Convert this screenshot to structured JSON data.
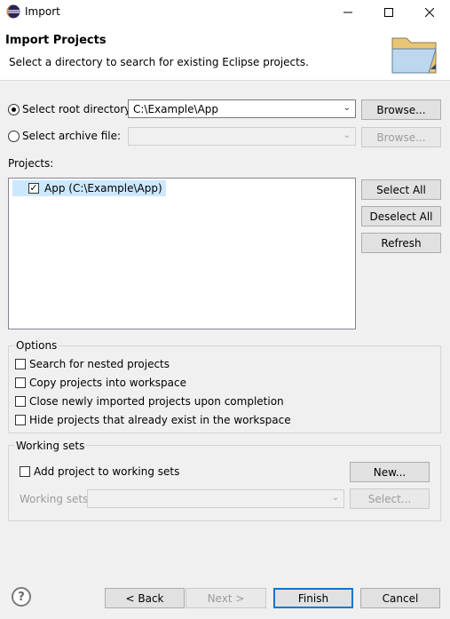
{
  "window": {
    "title": "Import"
  },
  "header": {
    "title": "Import Projects",
    "description": "Select a directory to search for existing Eclipse projects."
  },
  "source": {
    "root_label": "Select root directory:",
    "root_value": "C:\\Example\\App",
    "archive_label": "Select archive file:",
    "archive_value": "",
    "browse_label": "Browse...",
    "selected": "root"
  },
  "projects": {
    "label": "Projects:",
    "items": [
      {
        "label": "App (C:\\Example\\App)",
        "checked": true
      }
    ],
    "select_all": "Select All",
    "deselect_all": "Deselect All",
    "refresh": "Refresh"
  },
  "options": {
    "title": "Options",
    "items": [
      {
        "label": "Search for nested projects",
        "checked": false
      },
      {
        "label": "Copy projects into workspace",
        "checked": false
      },
      {
        "label": "Close newly imported projects upon completion",
        "checked": false
      },
      {
        "label": "Hide projects that already exist in the workspace",
        "checked": false
      }
    ]
  },
  "working_sets": {
    "title": "Working sets",
    "add_label": "Add project to working sets",
    "add_checked": false,
    "new_label": "New...",
    "sets_label": "Working sets:",
    "sets_value": "",
    "select_label": "Select..."
  },
  "footer": {
    "help": "?",
    "back": "< Back",
    "next": "Next >",
    "finish": "Finish",
    "cancel": "Cancel"
  }
}
